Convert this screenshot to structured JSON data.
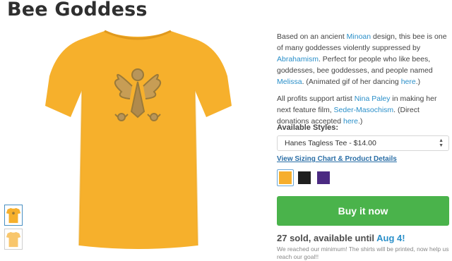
{
  "product": {
    "title": "Bee Goddess"
  },
  "description": {
    "p1": [
      "Based on an ancient ",
      "Minoan",
      " design, this bee is one of many goddesses violently suppressed by ",
      "Abrahamism",
      ". Perfect for people who like bees, goddesses, bee goddesses, and people named ",
      "Melissa",
      ". (Animated gif of her dancing ",
      "here",
      ".)"
    ],
    "p2": [
      "All profits support artist ",
      "Nina Paley",
      " in making her next feature film, ",
      "Seder-Masochism",
      ". (Direct donations accepted ",
      "here",
      ".)"
    ]
  },
  "styles": {
    "label": "Available Styles:",
    "selected": "Hanes Tagless Tee - $14.00",
    "sizing_link": "View Sizing Chart & Product Details",
    "colors": [
      {
        "name": "gold",
        "hex": "#f6ae2d",
        "selected": true
      },
      {
        "name": "black",
        "hex": "#1f1f1f",
        "selected": false
      },
      {
        "name": "purple",
        "hex": "#4b2a82",
        "selected": false
      }
    ]
  },
  "buy": {
    "label": "Buy it now"
  },
  "campaign": {
    "sold_prefix": "27 sold, available until ",
    "end_date": "Aug 4!",
    "note": "We reached our minimum! The shirts will be printed, now help us reach our goal!!"
  },
  "colors": {
    "shirt": "#f6b02c",
    "button": "#4ab34b",
    "link": "#2a8fc9"
  }
}
